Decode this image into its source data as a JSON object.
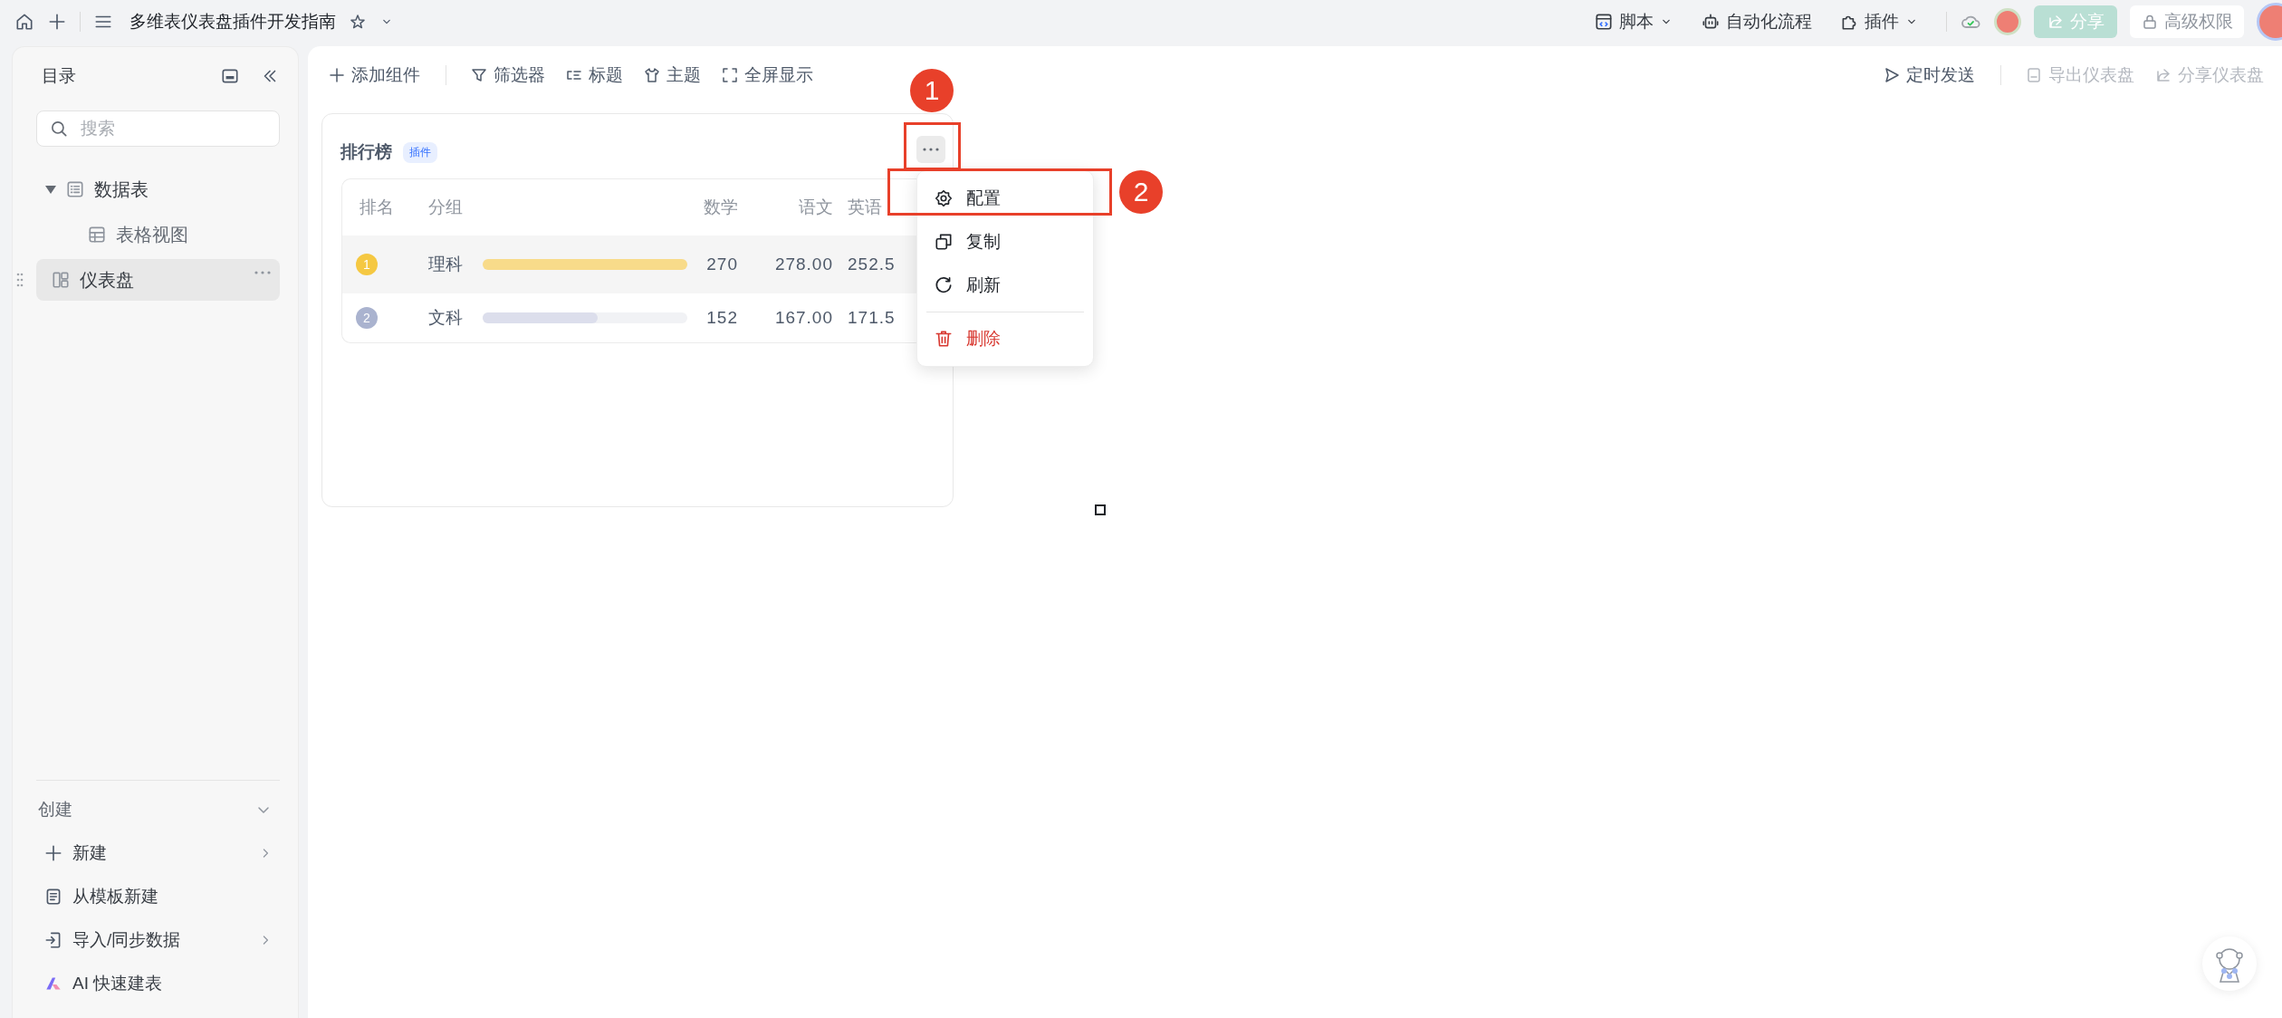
{
  "topbar": {
    "title": "多维表仪表盘插件开发指南",
    "actions": [
      {
        "label": "脚本",
        "kind": "script",
        "has_menu": true
      },
      {
        "label": "自动化流程",
        "kind": "robot",
        "has_menu": false
      },
      {
        "label": "插件",
        "kind": "plugin",
        "has_menu": true
      }
    ],
    "share_button": "分享",
    "permission_button": "高级权限"
  },
  "sidebar": {
    "title": "目录",
    "search": {
      "placeholder": "搜索"
    },
    "tree": [
      {
        "label": "数据表",
        "kind": "table",
        "expanded": true,
        "selected": false,
        "children": [
          {
            "label": "表格视图",
            "kind": "grid",
            "selected": false
          }
        ]
      },
      {
        "label": "仪表盘",
        "kind": "dashboard",
        "selected": true
      }
    ],
    "create_section": {
      "title": "创建",
      "expanded": true,
      "items": [
        {
          "label": "新建",
          "kind": "plus",
          "has_submenu": true
        },
        {
          "label": "从模板新建",
          "kind": "template",
          "has_submenu": false
        },
        {
          "label": "导入/同步数据",
          "kind": "import",
          "has_submenu": true
        },
        {
          "label": "AI 快速建表",
          "kind": "ai",
          "has_submenu": false
        }
      ]
    }
  },
  "toolbar": {
    "left": [
      {
        "label": "添加组件",
        "kind": "add"
      },
      {
        "label": "筛选器",
        "kind": "filter"
      },
      {
        "label": "标题",
        "kind": "title"
      },
      {
        "label": "主题",
        "kind": "theme"
      },
      {
        "label": "全屏显示",
        "kind": "fullscreen"
      }
    ],
    "right": [
      {
        "label": "定时发送",
        "kind": "send",
        "disabled": false
      },
      {
        "label": "导出仪表盘",
        "kind": "export",
        "disabled": true
      },
      {
        "label": "分享仪表盘",
        "kind": "share",
        "disabled": true
      }
    ]
  },
  "widget": {
    "title": "排行榜",
    "badge": "插件",
    "table": {
      "columns": [
        "排名",
        "分组",
        "数学",
        "语文",
        "英语"
      ],
      "rows": [
        {
          "rank": "1",
          "group": "理科",
          "level": 1,
          "color": "#f8db8a",
          "math": "270",
          "chinese": "278.00",
          "english": "252.5"
        },
        {
          "rank": "2",
          "group": "文科",
          "level": 0.56,
          "color": "#dcdeec",
          "math": "152",
          "chinese": "167.00",
          "english": "171.5"
        }
      ]
    }
  },
  "context_menu": [
    {
      "label": "配置",
      "kind": "settings",
      "danger": false
    },
    {
      "label": "复制",
      "kind": "copy",
      "danger": false
    },
    {
      "label": "刷新",
      "kind": "refresh",
      "danger": false
    },
    {
      "label": "删除",
      "kind": "delete",
      "danger": true
    }
  ],
  "annotations": [
    "1",
    "2"
  ]
}
